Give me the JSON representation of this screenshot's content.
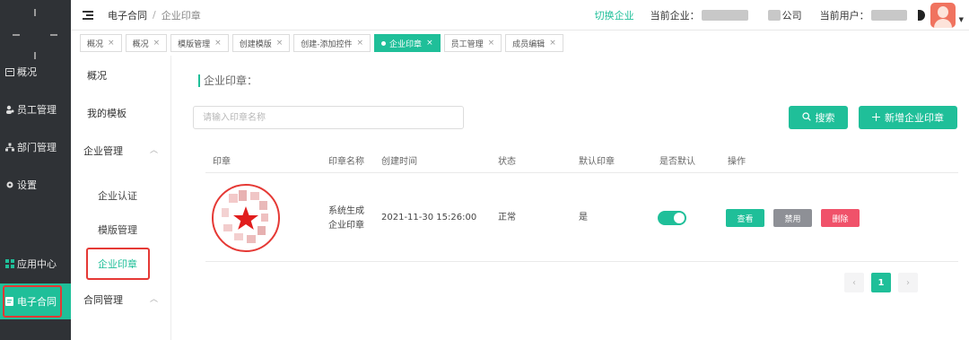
{
  "header": {
    "breadcrumb_app": "电子合同",
    "breadcrumb_sep": "/",
    "breadcrumb_page": "企业印章",
    "switch_company": "切换企业",
    "current_company_label": "当前企业：",
    "company_name_suffix": "公司",
    "current_user_label": "当前用户："
  },
  "sidebar": {
    "items": [
      {
        "label": "概况",
        "icon": "overview-icon"
      },
      {
        "label": "员工管理",
        "icon": "staff-icon"
      },
      {
        "label": "部门管理",
        "icon": "department-icon"
      },
      {
        "label": "设置",
        "icon": "gear-icon"
      },
      {
        "label": "应用中心",
        "icon": "apps-grid-icon"
      },
      {
        "label": "电子合同",
        "icon": "contract-icon"
      }
    ]
  },
  "tabs": [
    {
      "label": "概况"
    },
    {
      "label": "概况"
    },
    {
      "label": "模版管理"
    },
    {
      "label": "创建模版"
    },
    {
      "label": "创建-添加控件"
    },
    {
      "label": "企业印章",
      "active": true
    },
    {
      "label": "员工管理"
    },
    {
      "label": "成员编辑"
    }
  ],
  "tab_close": "×",
  "menu2": {
    "overview": "概况",
    "my_templates": "我的模板",
    "company_mgmt": "企业管理",
    "company_auth": "企业认证",
    "template_mgmt": "模版管理",
    "company_seal": "企业印章",
    "contract_mgmt": "合同管理",
    "collapse_arrow": "︿"
  },
  "main": {
    "section_title": "企业印章：",
    "search_placeholder": "请输入印章名称",
    "search_button": "搜索",
    "add_button": "新增企业印章",
    "columns": [
      "印章",
      "印章名称",
      "创建时间",
      "状态",
      "默认印章",
      "是否默认",
      "操作"
    ],
    "rows": [
      {
        "name_line1": "系统生成",
        "name_line2": "企业印章",
        "created": "2021-11-30 15:26:00",
        "status": "正常",
        "default_seal": "是",
        "is_default": true,
        "actions": {
          "view": "查看",
          "disable": "禁用",
          "delete": "删除"
        }
      }
    ]
  },
  "pagination": {
    "prev": "‹",
    "current": "1",
    "next": "›"
  },
  "colors": {
    "accent": "#1fbf99",
    "sidebar_bg": "#2f3236",
    "danger": "#f0526a",
    "muted": "#8e9096",
    "highlight_frame": "#e53935"
  }
}
